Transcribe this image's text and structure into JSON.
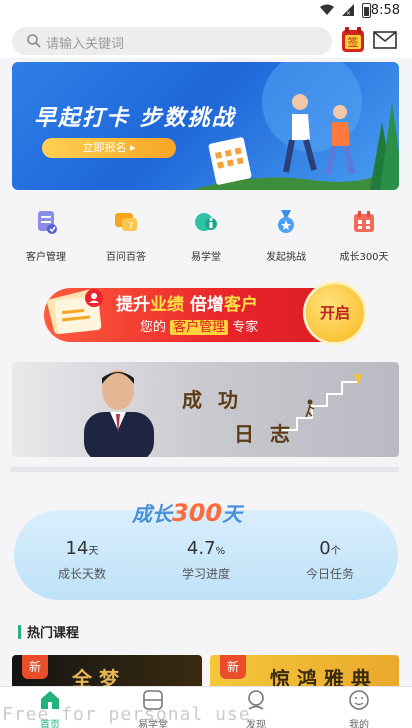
{
  "status": {
    "time": "8:58"
  },
  "search": {
    "placeholder": "请输入关键词"
  },
  "header": {
    "sign_label": "签"
  },
  "banner": {
    "title": "早起打卡 步数挑战",
    "cta": "立即报名 ▸"
  },
  "quicknav": [
    {
      "label": "客户管理",
      "icon": "customer-icon"
    },
    {
      "label": "百问百答",
      "icon": "qa-icon"
    },
    {
      "label": "易学堂",
      "icon": "school-icon"
    },
    {
      "label": "发起挑战",
      "icon": "medal-icon"
    },
    {
      "label": "成长300天",
      "icon": "calendar-icon"
    }
  ],
  "promo": {
    "line1_a": "提升",
    "line1_b": "业绩",
    "line1_c": " 倍增",
    "line1_d": "客户",
    "line2_a": "您的 ",
    "line2_b": "客户管理",
    "line2_c": " 专家",
    "button": "开启"
  },
  "success_banner": {
    "word1": "成功",
    "word2": "日志"
  },
  "growth": {
    "title_a": "成长",
    "title_num": "300",
    "title_b": "天",
    "stats": [
      {
        "value": "14",
        "unit": "天",
        "label": "成长天数"
      },
      {
        "value": "4.7",
        "unit": "%",
        "label": "学习进度"
      },
      {
        "value": "0",
        "unit": "个",
        "label": "今日任务"
      }
    ]
  },
  "hot": {
    "title": "热门课程"
  },
  "courses": [
    {
      "tag": "新",
      "title": "全 梦"
    },
    {
      "tag": "新",
      "title": "惊 鸿 雅 典"
    }
  ],
  "tabs": [
    {
      "label": "首页",
      "icon": "home-icon",
      "active": true
    },
    {
      "label": "易学堂",
      "icon": "school-icon",
      "active": false
    },
    {
      "label": "发现",
      "icon": "discover-icon",
      "active": false
    },
    {
      "label": "我的",
      "icon": "profile-icon",
      "active": false
    }
  ],
  "watermark": "Free for personal use",
  "colors": {
    "accent": "#21b27a",
    "promo_red": "#e8232a",
    "banner_blue": "#1f66d9"
  }
}
